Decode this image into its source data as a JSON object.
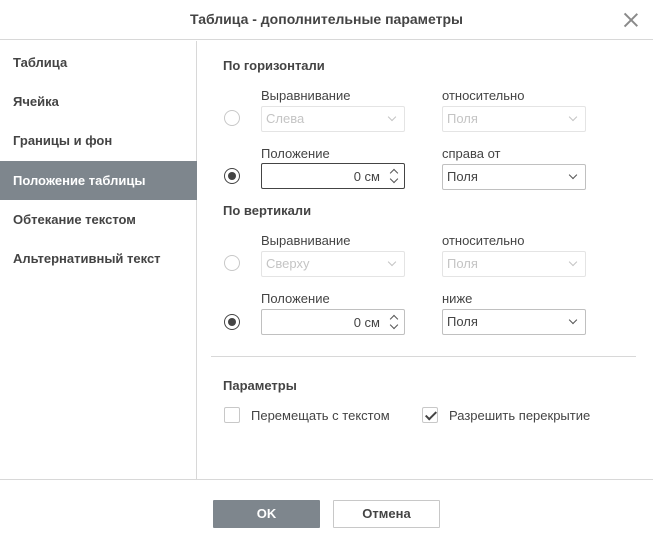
{
  "dialog": {
    "title": "Таблица - дополнительные параметры"
  },
  "sidebar": {
    "items": [
      {
        "label": "Таблица",
        "active": false
      },
      {
        "label": "Ячейка",
        "active": false
      },
      {
        "label": "Границы и фон",
        "active": false
      },
      {
        "label": "Положение таблицы",
        "active": true
      },
      {
        "label": "Обтекание текстом",
        "active": false
      },
      {
        "label": "Альтернативный текст",
        "active": false
      }
    ]
  },
  "horizontal": {
    "title": "По горизонтали",
    "alignment_label": "Выравнивание",
    "alignment_value": "Слева",
    "relative_label": "относительно",
    "relative_value": "Поля",
    "alignment_selected": false,
    "position_label": "Положение",
    "position_value": "0 см",
    "position_selected": true,
    "right_of_label": "справа от",
    "right_of_value": "Поля"
  },
  "vertical": {
    "title": "По вертикали",
    "alignment_label": "Выравнивание",
    "alignment_value": "Сверху",
    "relative_label": "относительно",
    "relative_value": "Поля",
    "alignment_selected": false,
    "position_label": "Положение",
    "position_value": "0 см",
    "position_selected": true,
    "below_label": "ниже",
    "below_value": "Поля"
  },
  "options": {
    "title": "Параметры",
    "move_with_text_label": "Перемещать с текстом",
    "move_with_text_checked": false,
    "allow_overlap_label": "Разрешить перекрытие",
    "allow_overlap_checked": true
  },
  "footer": {
    "ok_label": "OK",
    "cancel_label": "Отмена"
  },
  "colors": {
    "accent": "#7e868d",
    "text": "#444444",
    "border": "#d8d8d8"
  }
}
